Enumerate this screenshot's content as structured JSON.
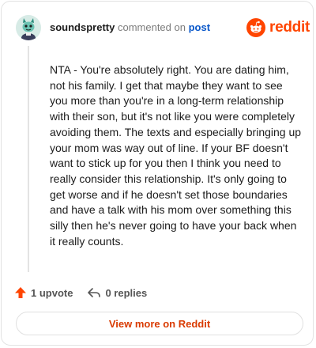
{
  "header": {
    "username": "soundspretty",
    "action_text": "commented on",
    "target_link": "post",
    "brand": "reddit"
  },
  "comment": {
    "body": "NTA - You're absolutely right. You are dating him, not his family. I get that maybe they want to see you more than you're in a long-term relationship with their son, but it's not like you were completely avoiding them. The texts and especially bringing up your mom was way out of line. If your BF doesn't want to stick up for you then I think you need to really consider this relationship. It's only going to get worse and if he doesn't set those boundaries and have a talk with his mom over something this silly then he's never going to have your back when it really counts."
  },
  "actions": {
    "upvote_label": "1 upvote",
    "replies_label": "0 replies"
  },
  "footer": {
    "view_more_label": "View more on Reddit"
  },
  "colors": {
    "brand_orange": "#ff4500",
    "link_blue": "#0a58ca",
    "button_text": "#d93a00"
  },
  "icons": {
    "avatar": "snoo-avatar",
    "logo": "reddit-snoo-icon",
    "upvote": "upvote-arrow-icon",
    "reply": "reply-arrow-icon"
  }
}
